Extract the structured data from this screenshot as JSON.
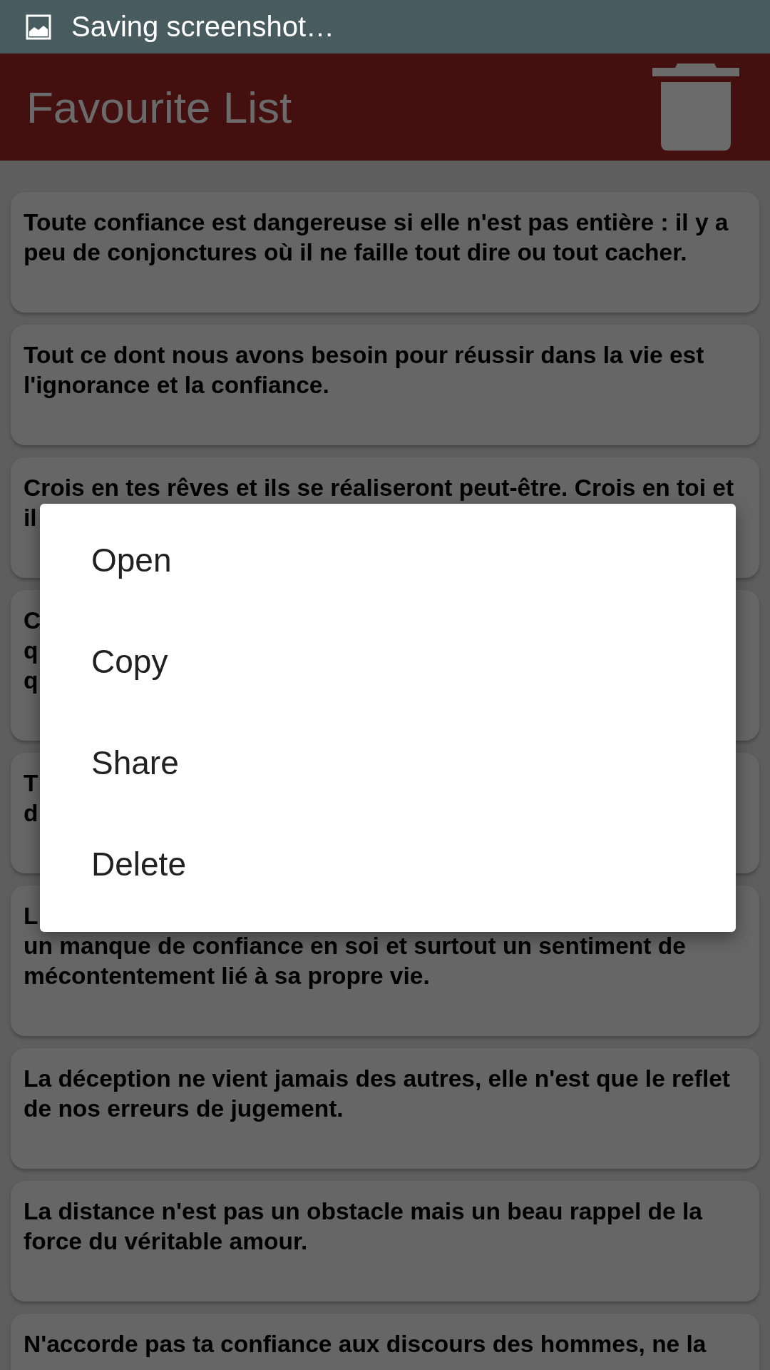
{
  "status_bar": {
    "text": "Saving screenshot…"
  },
  "app_bar": {
    "title": "Favourite List"
  },
  "quotes": [
    {
      "lines": [
        "Toute confiance est dangereuse si elle n'est pas entière : il y a",
        "peu de conjonctures où il ne faille tout dire ou tout cacher."
      ]
    },
    {
      "lines": [
        "Tout ce dont nous avons besoin pour réussir dans la vie est",
        "l'ignorance et la confiance."
      ]
    },
    {
      "lines": [
        "Crois en tes rêves et ils se réaliseront peut-être. Crois en toi et",
        "il"
      ]
    },
    {
      "lines": [
        "C",
        "q",
        "q"
      ]
    },
    {
      "lines": [
        "T",
        "d"
      ]
    },
    {
      "lines": [
        "L",
        "un manque de confiance en soi et surtout un sentiment de",
        "mécontentement lié à sa propre vie."
      ]
    },
    {
      "lines": [
        "La déception ne vient jamais des autres, elle n'est que le reflet",
        "de nos erreurs de jugement."
      ]
    },
    {
      "lines": [
        "La distance n'est pas un obstacle mais un beau rappel de la",
        "force du véritable amour."
      ]
    },
    {
      "lines": [
        "N'accorde pas ta confiance aux discours des hommes, ne la"
      ]
    }
  ],
  "menu": {
    "items": [
      {
        "label": "Open"
      },
      {
        "label": "Copy"
      },
      {
        "label": "Share"
      },
      {
        "label": "Delete"
      }
    ]
  }
}
